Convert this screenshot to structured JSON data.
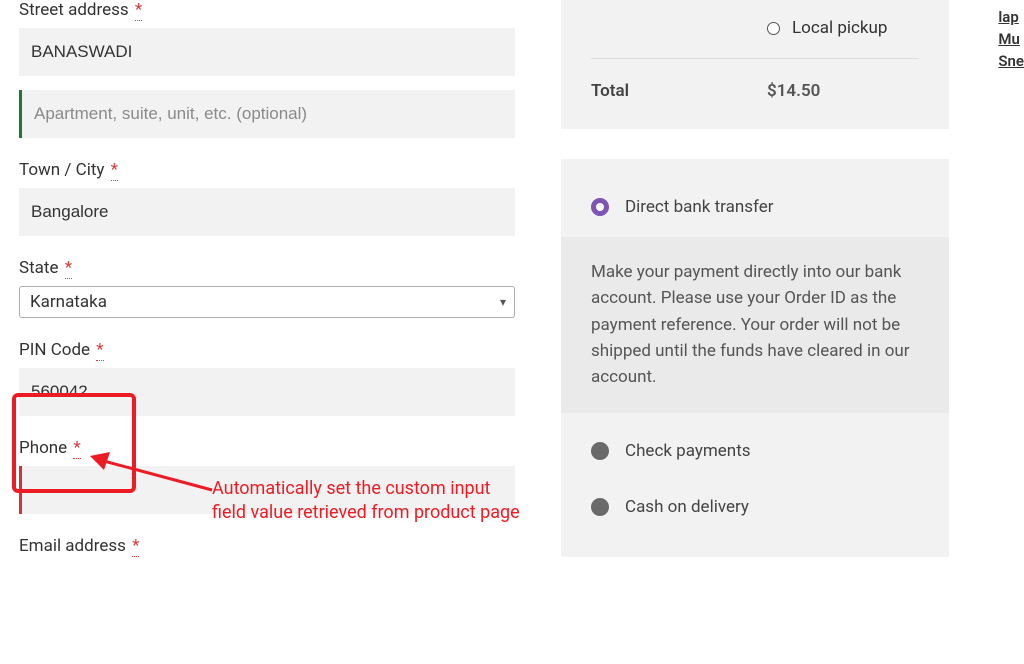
{
  "billing": {
    "street_label": "Street address",
    "street_value": "BANASWADI",
    "apt_placeholder": "Apartment, suite, unit, etc. (optional)",
    "apt_value": "",
    "city_label": "Town / City",
    "city_value": "Bangalore",
    "state_label": "State",
    "state_value": "Karnataka",
    "pin_label": "PIN Code",
    "pin_value": "560042",
    "phone_label": "Phone",
    "phone_value": "",
    "email_label": "Email address",
    "required_mark": "*"
  },
  "order": {
    "shipping_options": [
      {
        "label": "Local pickup",
        "selected": false
      }
    ],
    "total_label": "Total",
    "total_value": "$14.50"
  },
  "payment": {
    "methods": [
      {
        "id": "bacs",
        "label": "Direct bank transfer",
        "selected": true
      },
      {
        "id": "cheque",
        "label": "Check payments",
        "selected": false
      },
      {
        "id": "cod",
        "label": "Cash on delivery",
        "selected": false
      }
    ],
    "bacs_description": "Make your payment directly into our bank account. Please use your Order ID as the payment reference. Your order will not be shipped until the funds have cleared in our account."
  },
  "side_links": [
    "lap",
    "Mu",
    "Sne"
  ],
  "annotation": {
    "text": "Automatically set the custom input field value retrieved from product page"
  }
}
